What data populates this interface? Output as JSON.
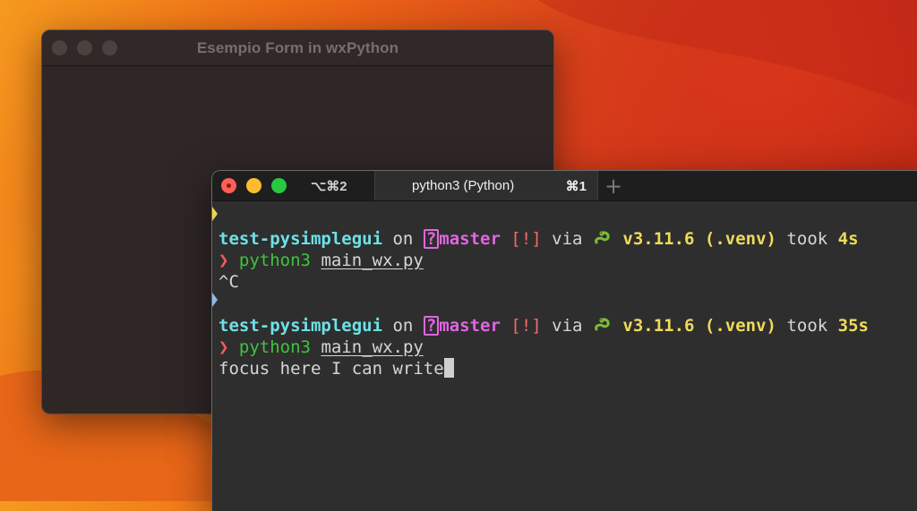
{
  "wx_window": {
    "title": "Esempio Form in wxPython"
  },
  "terminal": {
    "tabs": [
      {
        "label": "⌥⌘2",
        "active": false
      },
      {
        "label": "python3 (Python)",
        "shortcut": "⌘1",
        "active": true
      }
    ],
    "new_tab": "+",
    "session1": {
      "dir": "test-pysimplegui",
      "on": "on",
      "branch_icon": "?",
      "branch": "master",
      "status": "[!]",
      "via": "via",
      "py_icon": "python-snake-icon",
      "version": "v3.11.6 (.venv)",
      "took": "took",
      "duration": "4s",
      "prompt": "❯",
      "cmd": "python3",
      "arg": "main_wx.py",
      "output": "^C"
    },
    "session2": {
      "dir": "test-pysimplegui",
      "on": "on",
      "branch_icon": "?",
      "branch": "master",
      "status": "[!]",
      "via": "via",
      "py_icon": "python-snake-icon",
      "version": "v3.11.6 (.venv)",
      "took": "took",
      "duration": "35s",
      "prompt": "❯",
      "cmd": "python3",
      "arg": "main_wx.py",
      "output": "focus here I can write"
    }
  },
  "colors": {
    "dir": "#6ee0e6",
    "branch": "#e066e0",
    "status": "#f26b6b",
    "version": "#eedb5a",
    "cmd": "#3ec43e",
    "prompt": "#f25d5d"
  }
}
